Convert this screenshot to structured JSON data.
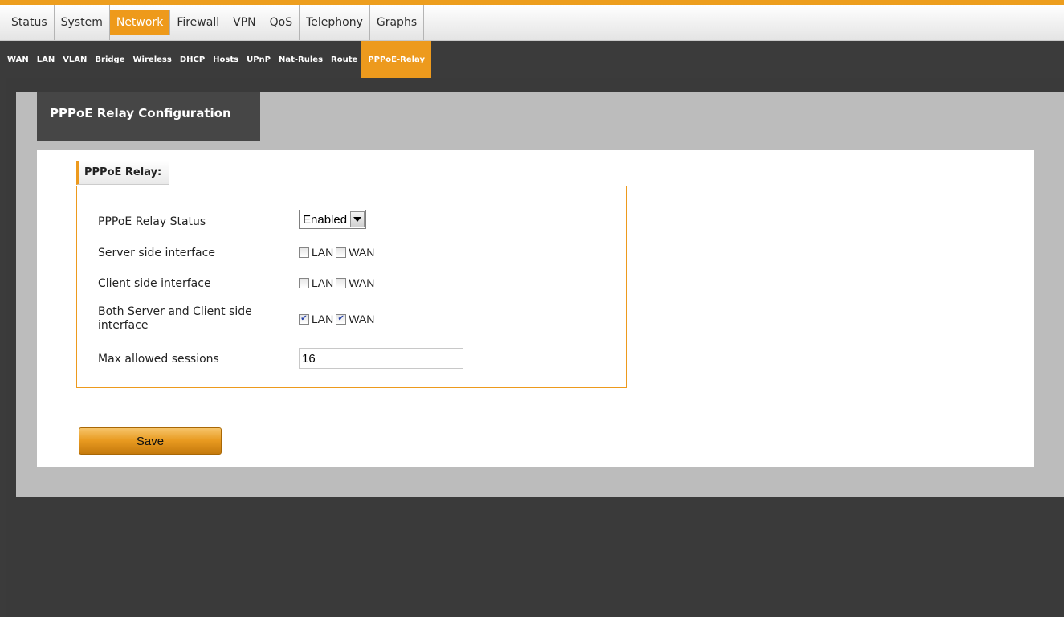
{
  "main_nav": {
    "tabs": [
      "Status",
      "System",
      "Network",
      "Firewall",
      "VPN",
      "QoS",
      "Telephony",
      "Graphs"
    ],
    "active": "Network"
  },
  "sub_nav": {
    "tabs": [
      "WAN",
      "LAN",
      "VLAN",
      "Bridge",
      "Wireless",
      "DHCP",
      "Hosts",
      "UPnP",
      "Nat-Rules",
      "Route",
      "PPPoE-Relay"
    ],
    "active": "PPPoE-Relay"
  },
  "page": {
    "title": "PPPoE Relay Configuration",
    "section_title": "PPPoE Relay:"
  },
  "form": {
    "relay_status": {
      "label": "PPPoE Relay Status",
      "value": "Enabled"
    },
    "server_side": {
      "label": "Server side interface",
      "lan": "LAN",
      "wan": "WAN",
      "lan_checked": false,
      "wan_checked": false
    },
    "client_side": {
      "label": "Client side interface",
      "lan": "LAN",
      "wan": "WAN",
      "lan_checked": false,
      "wan_checked": false
    },
    "both_side": {
      "label": "Both Server and Client side interface",
      "lan": "LAN",
      "wan": "WAN",
      "lan_checked": true,
      "wan_checked": true
    },
    "max_sessions": {
      "label": "Max allowed sessions",
      "value": "16"
    }
  },
  "actions": {
    "save_label": "Save"
  },
  "colors": {
    "accent": "#ed9a1d",
    "dark": "#3b3b3b",
    "panel": "#bcbcbc"
  }
}
